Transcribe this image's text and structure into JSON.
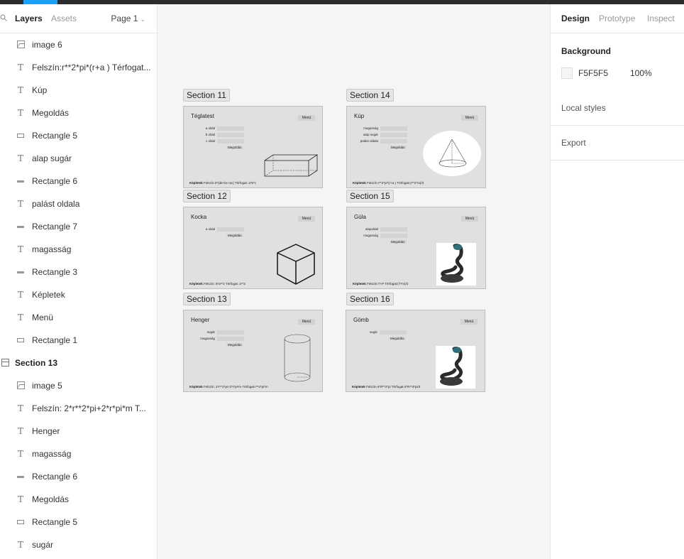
{
  "left_panel": {
    "tabs": {
      "layers": "Layers",
      "assets": "Assets"
    },
    "page": "Page 1",
    "layers": [
      {
        "type": "image",
        "label": "image 6"
      },
      {
        "type": "text",
        "label": "Felszín:r**2*pi*(r+a ) Térfogat..."
      },
      {
        "type": "text",
        "label": "Kúp"
      },
      {
        "type": "text",
        "label": "Megoldás"
      },
      {
        "type": "rect",
        "label": "Rectangle 5"
      },
      {
        "type": "text",
        "label": "alap sugár"
      },
      {
        "type": "line",
        "label": "Rectangle 6"
      },
      {
        "type": "text",
        "label": "palást oldala"
      },
      {
        "type": "line",
        "label": "Rectangle 7"
      },
      {
        "type": "text",
        "label": "magasság"
      },
      {
        "type": "line",
        "label": "Rectangle 3"
      },
      {
        "type": "text",
        "label": "Képletek"
      },
      {
        "type": "text",
        "label": "Menü"
      },
      {
        "type": "rect",
        "label": "Rectangle 1"
      },
      {
        "type": "section",
        "label": "Section 13"
      },
      {
        "type": "image",
        "label": "image 5"
      },
      {
        "type": "text",
        "label": "Felszín: 2*r**2*pi+2*r*pi*m T..."
      },
      {
        "type": "text",
        "label": "Henger"
      },
      {
        "type": "text",
        "label": "magasság"
      },
      {
        "type": "line",
        "label": "Rectangle 6"
      },
      {
        "type": "text",
        "label": "Megoldás"
      },
      {
        "type": "rect",
        "label": "Rectangle 5"
      },
      {
        "type": "text",
        "label": "sugár"
      }
    ]
  },
  "canvas": {
    "background": "#F5F5F5",
    "sections": [
      {
        "label": "Section 11",
        "title": "Téglatest",
        "menu": "Menü",
        "fields": [
          "a oldal",
          "b oldal",
          "c oldal"
        ],
        "button": "Megoldás",
        "formula_label": "Képletek",
        "formula": "Felszín:2*(ab+bc+ac)   Térfogat: a*b*c",
        "figure": "cuboid"
      },
      {
        "label": "Section 14",
        "title": "Kúp",
        "menu": "Menü",
        "fields": [
          "magasság",
          "alap sugár",
          "palást oldala"
        ],
        "button": "Megoldás",
        "formula_label": "Képletek",
        "formula": "Felszín:r**2*pi*(r+a ) Térfogat:(r**2*m)/3",
        "figure": "cone"
      },
      {
        "label": "Section 12",
        "title": "Kocka",
        "menu": "Menü",
        "fields": [
          "a oldal"
        ],
        "button": "Megoldás",
        "formula_label": "Képletek",
        "formula": "Felszín: 6*a**2   Térfogat: a**3",
        "figure": "cube"
      },
      {
        "label": "Section 15",
        "title": "Gúla",
        "menu": "Menü",
        "fields": [
          "alapoldal",
          "magasság"
        ],
        "button": "Megoldás",
        "formula_label": "Képletek",
        "formula": "Felszín:T+P   Térfogat:(T*m)/3",
        "figure": "snake"
      },
      {
        "label": "Section 13",
        "title": "Henger",
        "menu": "Menü",
        "fields": [
          "sugár",
          "magasság"
        ],
        "button": "Megoldás",
        "formula_label": "Képletek",
        "formula": "Felszín: 2*r**2*pi+2*r*pi*m  Térfogat:r**2*pi*m",
        "figure": "cylinder"
      },
      {
        "label": "Section 16",
        "title": "Gömb",
        "menu": "Menü",
        "fields": [
          "sugár"
        ],
        "button": "Megoldás",
        "formula_label": "Képletek",
        "formula": "Felszín:4*R**2*pi  Térfogat:4*R**3*pi/3",
        "figure": "snake"
      }
    ]
  },
  "right_panel": {
    "tabs": {
      "design": "Design",
      "prototype": "Prototype",
      "inspect": "Inspect"
    },
    "background_title": "Background",
    "background_hex": "F5F5F5",
    "background_opacity": "100%",
    "local_styles": "Local styles",
    "export": "Export"
  }
}
